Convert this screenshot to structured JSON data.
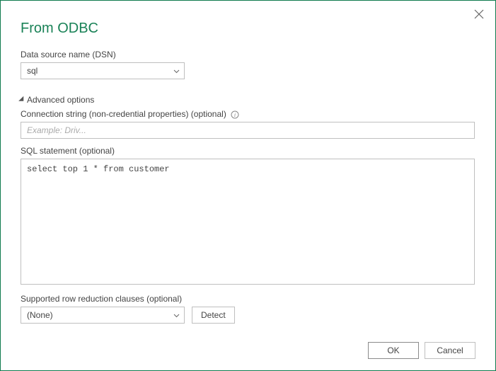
{
  "dialog": {
    "title": "From ODBC"
  },
  "dsn": {
    "label": "Data source name (DSN)",
    "value": "sql"
  },
  "advanced": {
    "header": "Advanced options"
  },
  "connString": {
    "label": "Connection string (non-credential properties) (optional)",
    "placeholder": "Example: Driv...",
    "value": ""
  },
  "sql": {
    "label": "SQL statement (optional)",
    "value": "select top 1 * from customer"
  },
  "rowReduction": {
    "label": "Supported row reduction clauses (optional)",
    "value": "(None)",
    "detectLabel": "Detect"
  },
  "footer": {
    "ok": "OK",
    "cancel": "Cancel"
  }
}
